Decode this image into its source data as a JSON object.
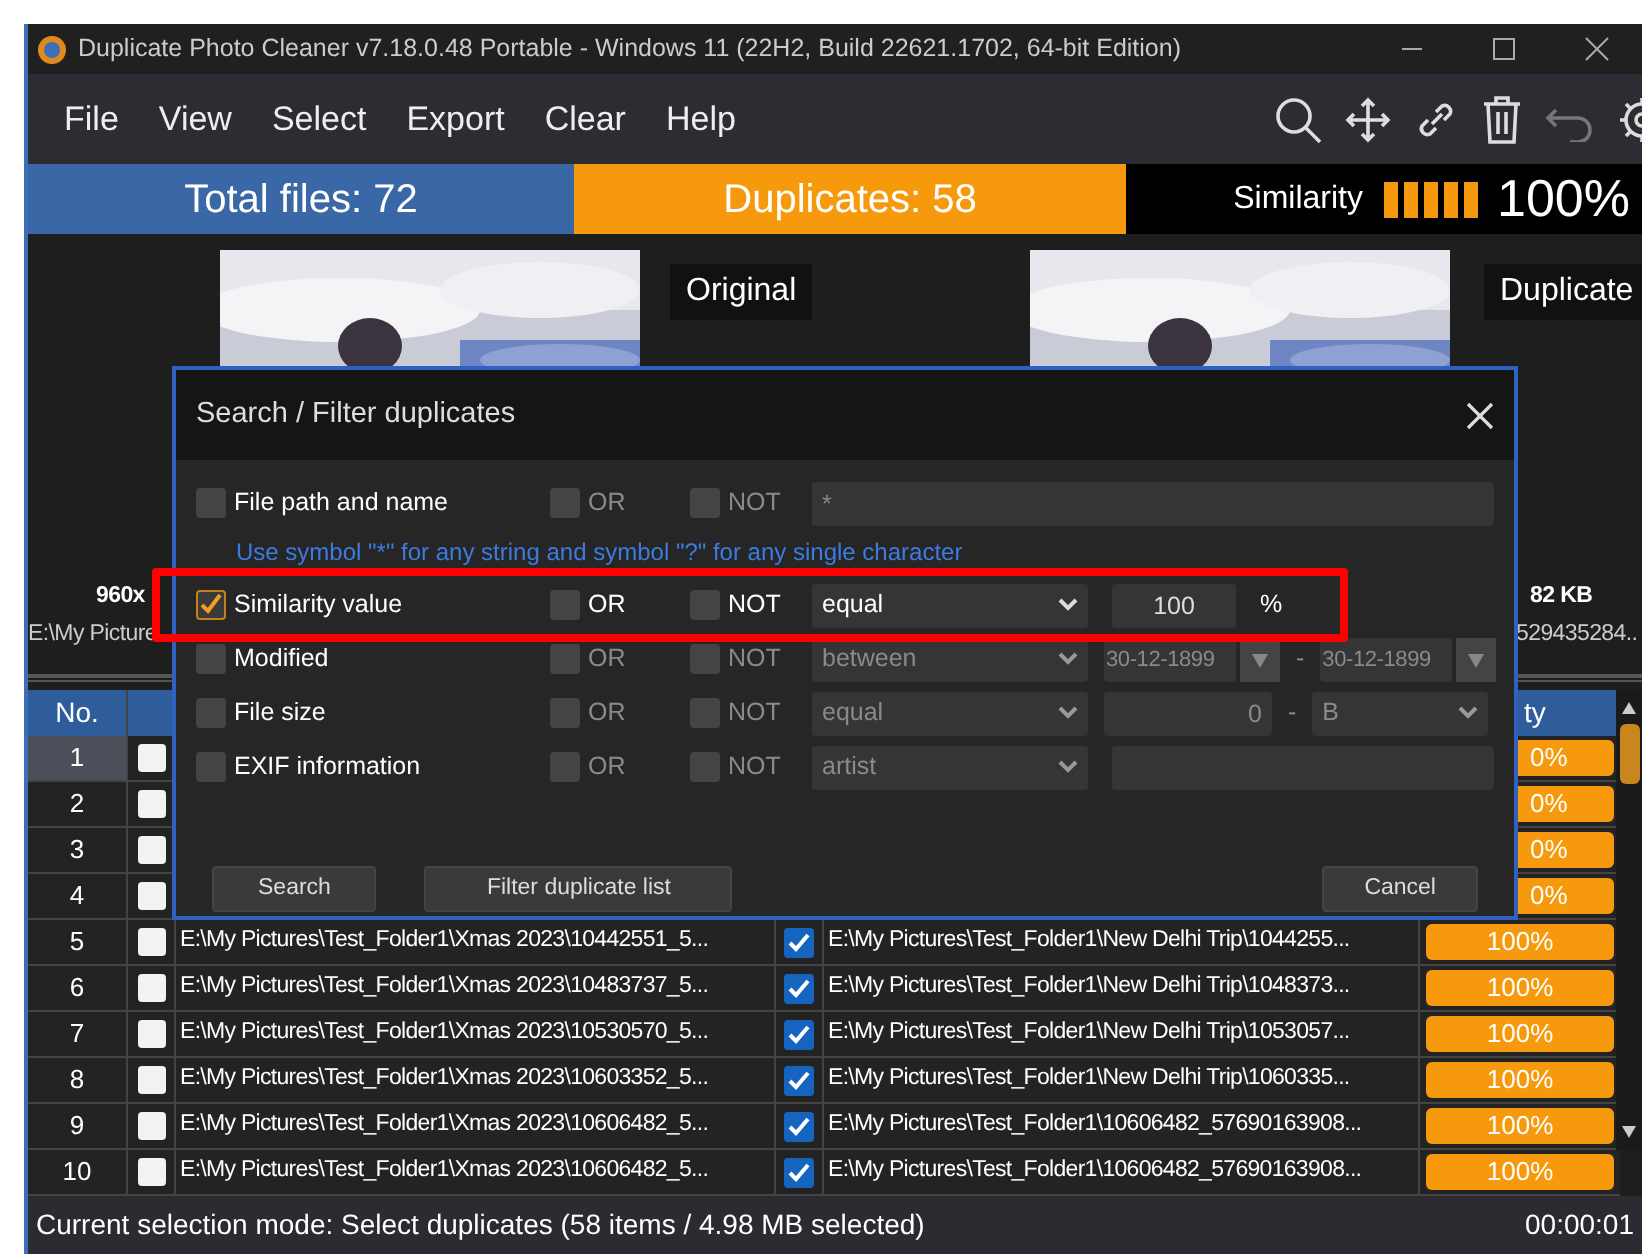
{
  "window": {
    "title": "Duplicate Photo Cleaner v7.18.0.48 Portable - Windows 11 (22H2, Build 22621.1702, 64-bit Edition)"
  },
  "menu": [
    "File",
    "View",
    "Select",
    "Export",
    "Clear",
    "Help"
  ],
  "stats": {
    "total": "Total files: 72",
    "duplicates": "Duplicates: 58",
    "similarity_label": "Similarity",
    "level": 1,
    "similarity": "100%"
  },
  "preview": {
    "original_label": "Original",
    "duplicate_label": "Duplicate",
    "left_size": "960x",
    "left_path": "E:\\My Picture",
    "right_size": "82 KB",
    "right_path": "529435284.."
  },
  "table": {
    "column_1": "No.",
    "column_6": "ty",
    "rows": [
      {
        "no": "1",
        "selected": true,
        "checked": false,
        "similarity": "0%"
      },
      {
        "no": "2",
        "selected": false,
        "checked": false,
        "similarity": "0%"
      },
      {
        "no": "3",
        "selected": false,
        "checked": false,
        "similarity": "0%"
      },
      {
        "no": "4",
        "selected": false,
        "checked": false,
        "similarity": "0%"
      },
      {
        "no": "5",
        "selected": false,
        "checked": false,
        "original": "E:\\My Pictures\\Test_Folder1\\Xmas 2023\\10442551_5...",
        "dup_checked": true,
        "duplicate": "E:\\My Pictures\\Test_Folder1\\New Delhi Trip\\1044255...",
        "similarity": "100%"
      },
      {
        "no": "6",
        "selected": false,
        "checked": false,
        "original": "E:\\My Pictures\\Test_Folder1\\Xmas 2023\\10483737_5...",
        "dup_checked": true,
        "duplicate": "E:\\My Pictures\\Test_Folder1\\New Delhi Trip\\1048373...",
        "similarity": "100%"
      },
      {
        "no": "7",
        "selected": false,
        "checked": false,
        "original": "E:\\My Pictures\\Test_Folder1\\Xmas 2023\\10530570_5...",
        "dup_checked": true,
        "duplicate": "E:\\My Pictures\\Test_Folder1\\New Delhi Trip\\1053057...",
        "similarity": "100%"
      },
      {
        "no": "8",
        "selected": false,
        "checked": false,
        "original": "E:\\My Pictures\\Test_Folder1\\Xmas 2023\\10603352_5...",
        "dup_checked": true,
        "duplicate": "E:\\My Pictures\\Test_Folder1\\New Delhi Trip\\1060335...",
        "similarity": "100%"
      },
      {
        "no": "9",
        "selected": false,
        "checked": false,
        "original": "E:\\My Pictures\\Test_Folder1\\Xmas 2023\\10606482_5...",
        "dup_checked": true,
        "duplicate": "E:\\My Pictures\\Test_Folder1\\10606482_57690163908...",
        "similarity": "100%"
      },
      {
        "no": "10",
        "selected": false,
        "checked": false,
        "original": "E:\\My Pictures\\Test_Folder1\\Xmas 2023\\10606482_5...",
        "dup_checked": true,
        "duplicate": "E:\\My Pictures\\Test_Folder1\\10606482_57690163908...",
        "similarity": "100%"
      }
    ]
  },
  "status_bar": {
    "text": "Current selection mode: Select duplicates (58 items / 4.98 MB selected)",
    "time": "00:00:01"
  },
  "dialog": {
    "title": "Search / Filter duplicates",
    "filters": [
      {
        "kind": "text",
        "label": "File path and name",
        "checked": false,
        "or": "OR",
        "or_checked": false,
        "not": "NOT",
        "not_checked": false,
        "value": "*",
        "highlighted": false
      },
      {
        "kind": "hint",
        "text": "Use symbol \"*\" for any string and symbol \"?\" for any single character"
      },
      {
        "kind": "select_number",
        "label": "Similarity value",
        "checked": true,
        "or": "OR",
        "or_checked": false,
        "not": "NOT",
        "not_checked": false,
        "select": "equal",
        "value": "100",
        "unit": "%",
        "highlighted": true
      },
      {
        "kind": "date_range",
        "label": "Modified",
        "checked": false,
        "or": "OR",
        "or_checked": false,
        "not": "NOT",
        "not_checked": false,
        "select": "between",
        "from": "30-12-1899",
        "separator": "-",
        "to": "30-12-1899",
        "highlighted": false
      },
      {
        "kind": "size",
        "label": "File size",
        "checked": false,
        "or": "OR",
        "or_checked": false,
        "not": "NOT",
        "not_checked": false,
        "select": "equal",
        "value": "0",
        "separator": "-",
        "unit": "B",
        "highlighted": false
      },
      {
        "kind": "text_select",
        "label": "EXIF information",
        "checked": false,
        "or": "OR",
        "or_checked": false,
        "not": "NOT",
        "not_checked": false,
        "select": "artist",
        "highlighted": false
      }
    ],
    "buttons": [
      "Search",
      "Filter duplicate list",
      "Cancel"
    ]
  }
}
